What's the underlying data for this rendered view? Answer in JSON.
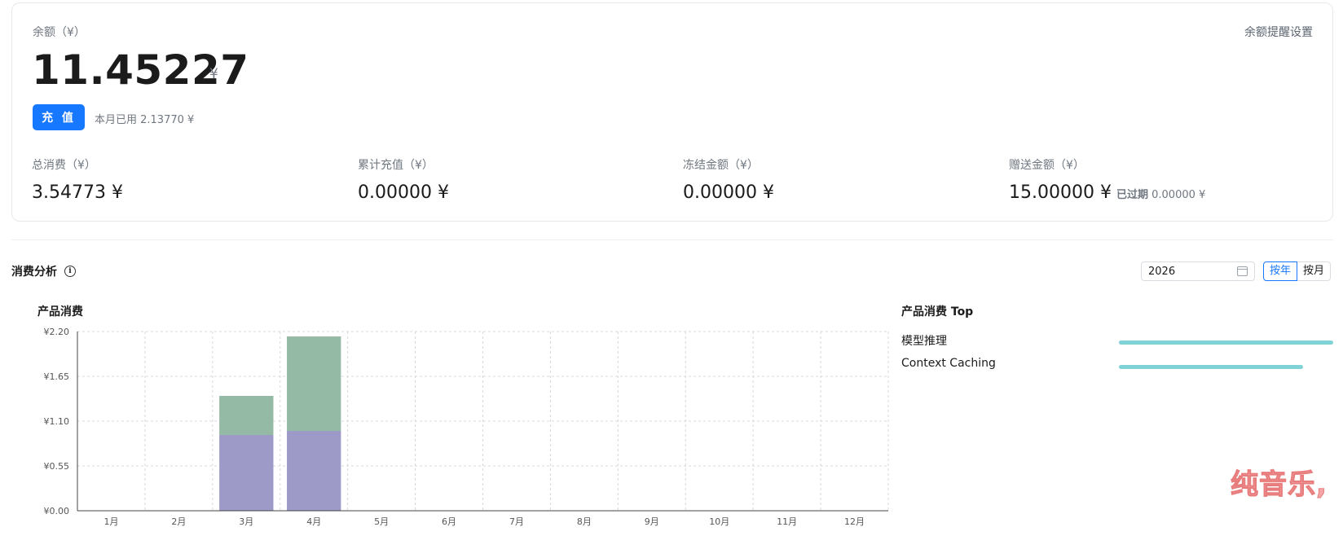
{
  "balance": {
    "label": "余额（¥）",
    "amount": "11.45227",
    "unit": "¥",
    "alert_link": "余额提醒设置",
    "recharge_label": "充 值",
    "month_used": "本月已用 2.13770 ¥"
  },
  "stats": [
    {
      "label": "总消费（¥）",
      "value": "3.54773 ¥"
    },
    {
      "label": "累计充值（¥）",
      "value": "0.00000 ¥"
    },
    {
      "label": "冻结金额（¥）",
      "value": "0.00000 ¥"
    },
    {
      "label": "赠送金额（¥）",
      "value": "15.00000 ¥",
      "sub_label": "已过期",
      "sub_value": "0.00000 ¥"
    }
  ],
  "analysis": {
    "title": "消费分析",
    "year": "2026",
    "toggle_year": "按年",
    "toggle_month": "按月",
    "chart_title": "产品消费",
    "top_title": "产品消费 Top"
  },
  "colors": {
    "accent": "#1677ff",
    "bar_bottom": "#9e9ac8",
    "bar_top": "#94b9a4",
    "top_bar": "#7fd3d6"
  },
  "chart_data": {
    "type": "bar",
    "stacked": true,
    "categories": [
      "1月",
      "2月",
      "3月",
      "4月",
      "5月",
      "6月",
      "7月",
      "8月",
      "9月",
      "10月",
      "11月",
      "12月"
    ],
    "series": [
      {
        "values": [
          0,
          0,
          0.93,
          0.98,
          0,
          0,
          0,
          0,
          0,
          0,
          0,
          0
        ]
      },
      {
        "values": [
          0,
          0,
          0.48,
          1.16,
          0,
          0,
          0,
          0,
          0,
          0,
          0,
          0
        ]
      }
    ],
    "yticks": [
      "¥0.00",
      "¥0.55",
      "¥1.10",
      "¥1.65",
      "¥2.20"
    ],
    "ylim": [
      0,
      2.2
    ],
    "grid": true
  },
  "top_products": [
    {
      "name": "模型推理",
      "value": 1.0
    },
    {
      "name": "Context Caching",
      "value": 0.86
    }
  ],
  "watermark": "纯音乐,"
}
